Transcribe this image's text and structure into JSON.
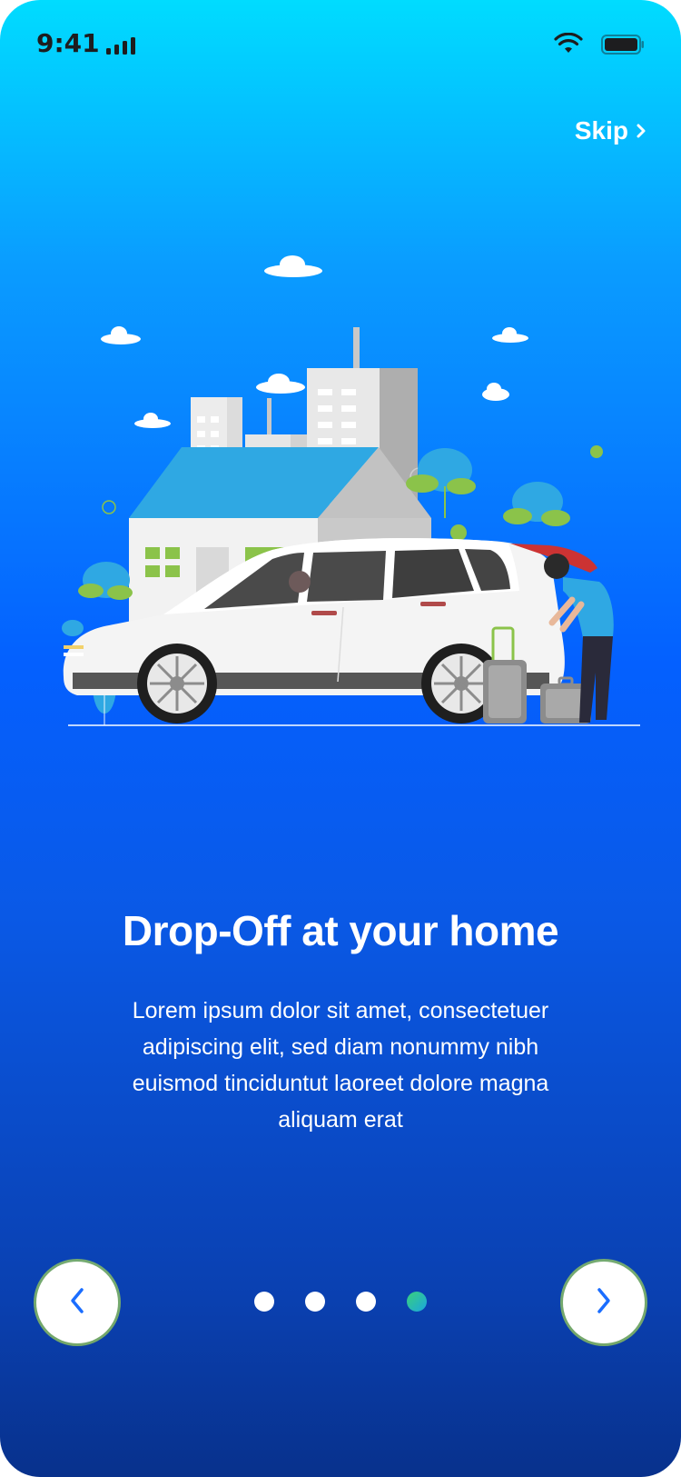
{
  "status_bar": {
    "time": "9:41",
    "icons": [
      "signal-icon",
      "wifi-icon",
      "battery-icon"
    ]
  },
  "skip": {
    "label": "Skip",
    "icon": "chevron-right-icon"
  },
  "illustration": {
    "icon": "car-drop-off-illustration"
  },
  "onboarding": {
    "title": "Drop-Off at your home",
    "description": "Lorem ipsum dolor sit amet, consectetuer adipiscing elit, sed diam nonummy nibh euismod tinciduntut laoreet dolore magna aliquam erat"
  },
  "pagination": {
    "total": 4,
    "current": 4
  },
  "navigation": {
    "prev_icon": "chevron-left-icon",
    "next_icon": "chevron-right-icon"
  },
  "colors": {
    "gradient_top": "#00dcff",
    "gradient_mid": "#0460ff",
    "gradient_bottom": "#08318c",
    "button_bg": "#ffffff",
    "button_ring": "#ccff38",
    "accent_arrow": "#1a6dff",
    "active_dot": "#2bbf9e"
  }
}
